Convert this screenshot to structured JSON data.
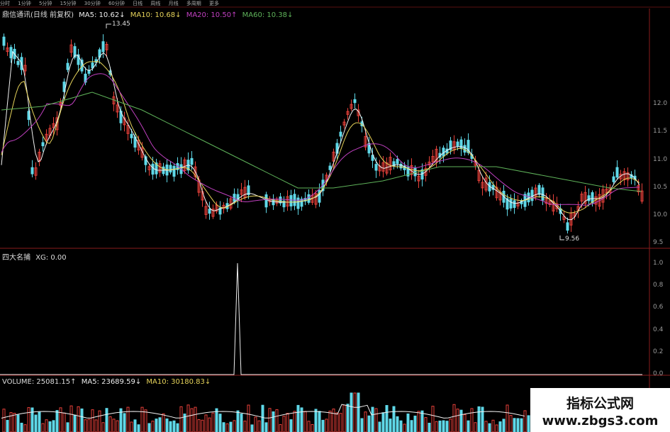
{
  "tabs": [
    "分时",
    "1分钟",
    "5分钟",
    "15分钟",
    "30分钟",
    "60分钟",
    "日线",
    "周线",
    "月线",
    "多周期",
    "更多"
  ],
  "price_header": {
    "title": "鼎信通讯(日线 前复权)",
    "ma5": "MA5: 10.62↓",
    "ma10": "MA10: 10.68↓",
    "ma20": "MA20: 10.50↑",
    "ma60": "MA60: 10.38↓"
  },
  "price_axis": [
    "12.0",
    "11.5",
    "11.0",
    "10.5",
    "10.0",
    "9.5"
  ],
  "annotations": {
    "high": "13.45",
    "low": "9.56"
  },
  "indicator_header": {
    "name": "四大名捕",
    "value": "XG: 0.00"
  },
  "indicator_axis": [
    "1.0",
    "0.8",
    "0.6",
    "0.4",
    "0.2",
    "0.0"
  ],
  "volume_header": {
    "volume": "VOLUME: 25081.15↑",
    "ma5": "MA5: 23689.59↓",
    "ma10": "MA10: 30180.83↓"
  },
  "watermark": {
    "line1": "指标公式网",
    "line2": "www.zbgs3.com"
  },
  "colors": {
    "up": "#e8413a",
    "down": "#5fd8e8",
    "ma5": "#f2f2f2",
    "ma10": "#e6d35a",
    "ma20": "#c040c0",
    "ma60": "#5fb35a"
  }
}
